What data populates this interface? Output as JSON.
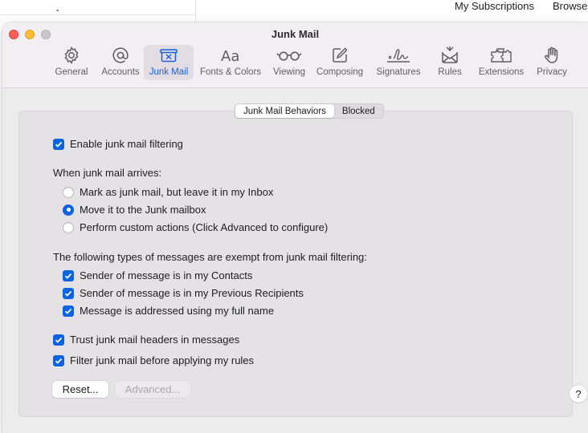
{
  "background_app": {
    "links": [
      "My Subscriptions",
      "Browse"
    ]
  },
  "window": {
    "title": "Junk Mail",
    "traffic_lights": [
      "close-icon",
      "minimize-icon",
      "zoom-icon"
    ]
  },
  "toolbar": {
    "items": [
      {
        "label": "General",
        "icon": "gear-icon",
        "active": false
      },
      {
        "label": "Accounts",
        "icon": "at-sign-icon",
        "active": false
      },
      {
        "label": "Junk Mail",
        "icon": "junk-tray-icon",
        "active": true
      },
      {
        "label": "Fonts & Colors",
        "icon": "font-icon",
        "active": false
      },
      {
        "label": "Viewing",
        "icon": "glasses-icon",
        "active": false
      },
      {
        "label": "Composing",
        "icon": "compose-icon",
        "active": false
      },
      {
        "label": "Signatures",
        "icon": "signature-icon",
        "active": false
      },
      {
        "label": "Rules",
        "icon": "rules-envelope-icon",
        "active": false
      },
      {
        "label": "Extensions",
        "icon": "puzzle-icon",
        "active": false
      },
      {
        "label": "Privacy",
        "icon": "hand-icon",
        "active": false
      }
    ]
  },
  "segmented": {
    "tabs": [
      "Junk Mail Behaviors",
      "Blocked"
    ],
    "selected": "Junk Mail Behaviors"
  },
  "junk": {
    "enable_label": "Enable junk mail filtering",
    "enable_checked": true,
    "arrives_heading": "When junk mail arrives:",
    "arrives_options": [
      {
        "label": "Mark as junk mail, but leave it in my Inbox",
        "selected": false
      },
      {
        "label": "Move it to the Junk mailbox",
        "selected": true
      },
      {
        "label": "Perform custom actions (Click Advanced to configure)",
        "selected": false
      }
    ],
    "exempt_heading": "The following types of messages are exempt from junk mail filtering:",
    "exempt_options": [
      {
        "label": "Sender of message is in my Contacts",
        "checked": true
      },
      {
        "label": "Sender of message is in my Previous Recipients",
        "checked": true
      },
      {
        "label": "Message is addressed using my full name",
        "checked": true
      }
    ],
    "trust_label": "Trust junk mail headers in messages",
    "trust_checked": true,
    "filter_label": "Filter junk mail before applying my rules",
    "filter_checked": true
  },
  "buttons": {
    "reset": "Reset...",
    "advanced": "Advanced...",
    "help": "?"
  },
  "colors": {
    "accent": "#0a64e0",
    "active_tab_text": "#1d62d6",
    "close": "#fe5f57",
    "minimize": "#febc2e"
  }
}
